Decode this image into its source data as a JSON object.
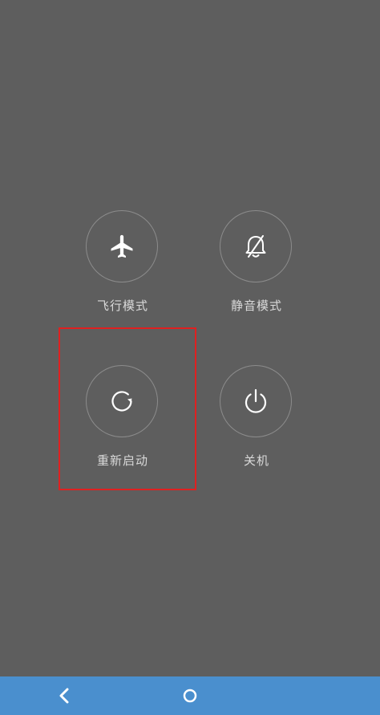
{
  "power_menu": {
    "actions": [
      {
        "id": "airplane",
        "label": "飞行模式",
        "icon": "airplane-icon"
      },
      {
        "id": "silent",
        "label": "静音模式",
        "icon": "bell-off-icon"
      },
      {
        "id": "reboot",
        "label": "重新启动",
        "icon": "restart-icon",
        "highlighted": true
      },
      {
        "id": "power",
        "label": "关机",
        "icon": "power-icon"
      }
    ]
  },
  "nav_bar": {
    "back_icon": "back-chevron-icon",
    "home_icon": "home-circle-icon"
  },
  "colors": {
    "background": "#5e5e5e",
    "circle_border": "#8c8c8c",
    "label_text": "#d9d9d9",
    "highlight": "#e02020",
    "nav_bar": "#4a8fce"
  }
}
